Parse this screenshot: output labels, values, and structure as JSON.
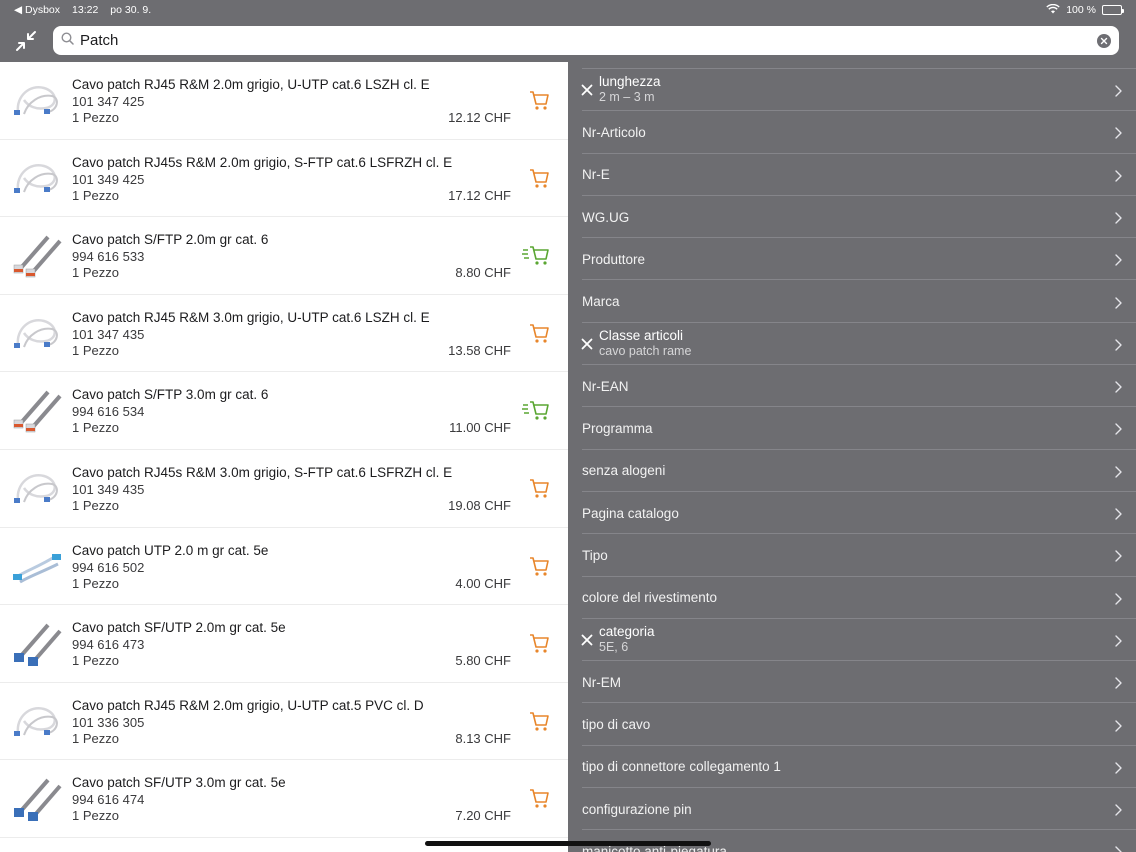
{
  "status_bar": {
    "back_app": "◀ Dysbox",
    "time": "13:22",
    "date": "po 30. 9.",
    "battery": "100 %"
  },
  "search": {
    "value": "Patch",
    "placeholder": ""
  },
  "products": [
    {
      "name": "Cavo patch RJ45 R&M 2.0m grigio, U-UTP cat.6 LSZH cl. E",
      "code": "101 347 425",
      "qty": "1 Pezzo",
      "price": "12.12 CHF",
      "cart": "orange",
      "thumb": "white"
    },
    {
      "name": "Cavo patch RJ45s R&M 2.0m grigio, S-FTP cat.6 LSFRZH cl. E",
      "code": "101 349 425",
      "qty": "1 Pezzo",
      "price": "17.12 CHF",
      "cart": "orange",
      "thumb": "white"
    },
    {
      "name": "Cavo patch S/FTP 2.0m gr cat. 6",
      "code": "994 616 533",
      "qty": "1 Pezzo",
      "price": "8.80 CHF",
      "cart": "green",
      "thumb": "grey-red"
    },
    {
      "name": "Cavo patch RJ45 R&M 3.0m grigio, U-UTP cat.6 LSZH cl. E",
      "code": "101 347 435",
      "qty": "1 Pezzo",
      "price": "13.58 CHF",
      "cart": "orange",
      "thumb": "white"
    },
    {
      "name": "Cavo patch S/FTP 3.0m gr cat. 6",
      "code": "994 616 534",
      "qty": "1 Pezzo",
      "price": "11.00 CHF",
      "cart": "green",
      "thumb": "grey-red"
    },
    {
      "name": "Cavo patch RJ45s R&M 3.0m grigio, S-FTP cat.6 LSFRZH cl. E",
      "code": "101 349 435",
      "qty": "1 Pezzo",
      "price": "19.08 CHF",
      "cart": "orange",
      "thumb": "white"
    },
    {
      "name": "Cavo patch UTP 2.0 m gr cat. 5e",
      "code": "994 616 502",
      "qty": "1 Pezzo",
      "price": "4.00 CHF",
      "cart": "orange",
      "thumb": "blue"
    },
    {
      "name": "Cavo patch SF/UTP 2.0m gr cat. 5e",
      "code": "994 616 473",
      "qty": "1 Pezzo",
      "price": "5.80 CHF",
      "cart": "orange",
      "thumb": "grey-blue"
    },
    {
      "name": "Cavo patch RJ45 R&M 2.0m grigio, U-UTP cat.5 PVC cl. D",
      "code": "101 336 305",
      "qty": "1 Pezzo",
      "price": "8.13 CHF",
      "cart": "orange",
      "thumb": "white"
    },
    {
      "name": "Cavo patch SF/UTP 3.0m gr cat. 5e",
      "code": "994 616 474",
      "qty": "1 Pezzo",
      "price": "7.20 CHF",
      "cart": "orange",
      "thumb": "grey-blue"
    }
  ],
  "filters": [
    {
      "label": "lunghezza",
      "value": "2 m – 3 m",
      "active": true
    },
    {
      "label": "Nr-Articolo",
      "value": "",
      "active": false
    },
    {
      "label": "Nr-E",
      "value": "",
      "active": false
    },
    {
      "label": "WG.UG",
      "value": "",
      "active": false
    },
    {
      "label": "Produttore",
      "value": "",
      "active": false
    },
    {
      "label": "Marca",
      "value": "",
      "active": false
    },
    {
      "label": "Classe articoli",
      "value": "cavo patch rame",
      "active": true
    },
    {
      "label": "Nr-EAN",
      "value": "",
      "active": false
    },
    {
      "label": "Programma",
      "value": "",
      "active": false
    },
    {
      "label": "senza alogeni",
      "value": "",
      "active": false
    },
    {
      "label": "Pagina catalogo",
      "value": "",
      "active": false
    },
    {
      "label": "Tipo",
      "value": "",
      "active": false
    },
    {
      "label": "colore del rivestimento",
      "value": "",
      "active": false
    },
    {
      "label": "categoria",
      "value": "5E, 6",
      "active": true
    },
    {
      "label": "Nr-EM",
      "value": "",
      "active": false
    },
    {
      "label": "tipo di cavo",
      "value": "",
      "active": false
    },
    {
      "label": "tipo di connettore collegamento 1",
      "value": "",
      "active": false
    },
    {
      "label": "configurazione pin",
      "value": "",
      "active": false
    },
    {
      "label": "manicotto anti-piegatura",
      "value": "",
      "active": false
    }
  ],
  "colors": {
    "cart_orange": "#e8862b",
    "cart_green": "#5aa632",
    "panel_bg": "#6d6d71"
  }
}
